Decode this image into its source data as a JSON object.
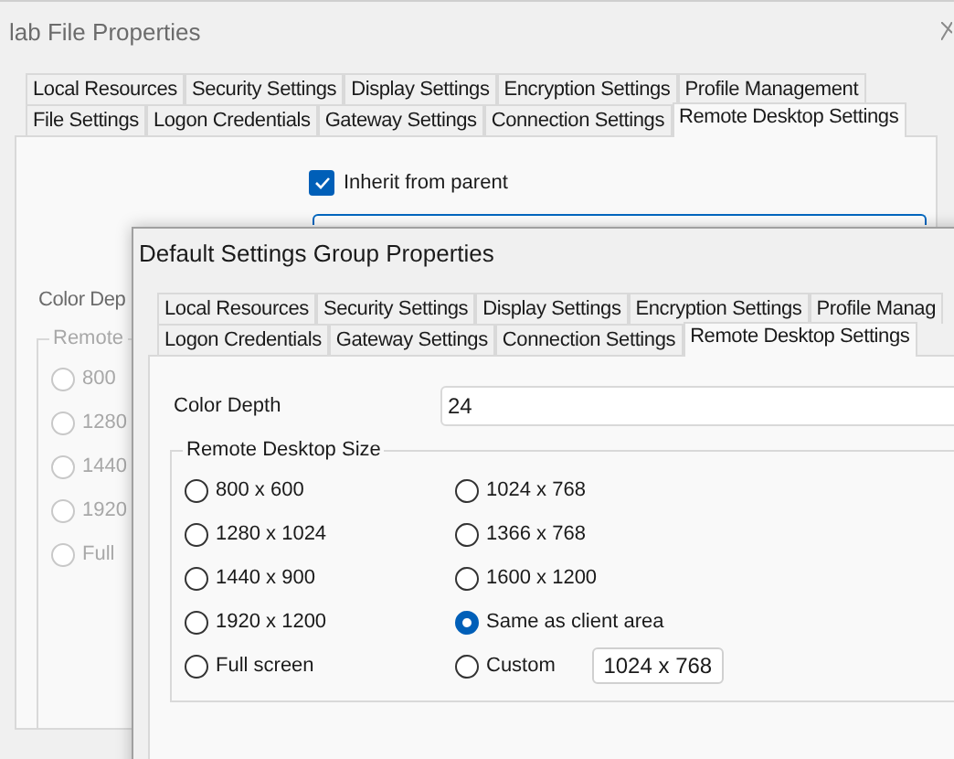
{
  "back_window": {
    "title": "lab File Properties",
    "tab_rows": [
      [
        {
          "label": "Local Resources",
          "selected": false
        },
        {
          "label": "Security Settings",
          "selected": false
        },
        {
          "label": "Display Settings",
          "selected": false
        },
        {
          "label": "Encryption Settings",
          "selected": false
        },
        {
          "label": "Profile Management",
          "selected": false
        }
      ],
      [
        {
          "label": "File Settings",
          "selected": false
        },
        {
          "label": "Logon Credentials",
          "selected": false
        },
        {
          "label": "Gateway Settings",
          "selected": false
        },
        {
          "label": "Connection Settings",
          "selected": false
        },
        {
          "label": "Remote Desktop Settings",
          "selected": true
        }
      ]
    ],
    "inherit": {
      "label": "Inherit from parent",
      "checked": true
    },
    "color_depth_label": "Color Dep",
    "size_group": {
      "label": "Remote",
      "options": [
        {
          "label": "800",
          "selected": false,
          "disabled": true
        },
        {
          "label": "1280",
          "selected": false,
          "disabled": true
        },
        {
          "label": "1440",
          "selected": false,
          "disabled": true
        },
        {
          "label": "1920",
          "selected": false,
          "disabled": true
        },
        {
          "label": "Full",
          "selected": false,
          "disabled": true
        }
      ]
    }
  },
  "front_window": {
    "title": "Default Settings Group Properties",
    "tab_rows": [
      [
        {
          "label": "Local Resources",
          "selected": false
        },
        {
          "label": "Security Settings",
          "selected": false
        },
        {
          "label": "Display Settings",
          "selected": false
        },
        {
          "label": "Encryption Settings",
          "selected": false
        },
        {
          "label": "Profile Manag",
          "selected": false
        }
      ],
      [
        {
          "label": "Logon Credentials",
          "selected": false
        },
        {
          "label": "Gateway Settings",
          "selected": false
        },
        {
          "label": "Connection Settings",
          "selected": false
        },
        {
          "label": "Remote Desktop Settings",
          "selected": true
        }
      ]
    ],
    "color_depth": {
      "label": "Color Depth",
      "value": "24"
    },
    "size_group": {
      "label": "Remote Desktop Size",
      "options": [
        {
          "label": "800 x 600",
          "selected": false
        },
        {
          "label": "1024 x 768",
          "selected": false
        },
        {
          "label": "1280 x 1024",
          "selected": false
        },
        {
          "label": "1366 x 768",
          "selected": false
        },
        {
          "label": "1440 x 900",
          "selected": false
        },
        {
          "label": "1600 x 1200",
          "selected": false
        },
        {
          "label": "1920 x 1200",
          "selected": false
        },
        {
          "label": "Same as client area",
          "selected": true
        },
        {
          "label": "Full screen",
          "selected": false
        },
        {
          "label": "Custom",
          "selected": false,
          "value": "1024 x 768"
        }
      ]
    }
  }
}
